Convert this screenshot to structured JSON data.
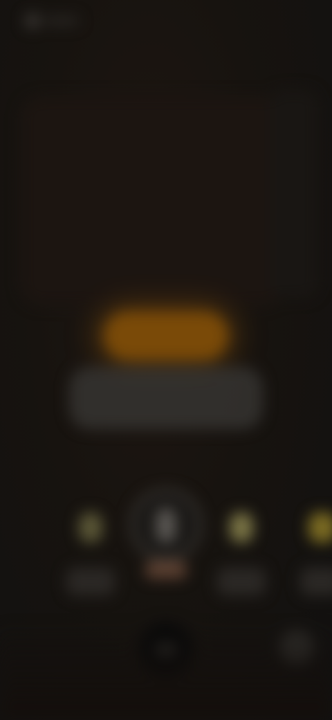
{
  "status_bar": {
    "icon": "clock-icon",
    "time_text": ""
  },
  "viewfinder": {
    "blurred": true
  },
  "countdown": {
    "indicator_text": "",
    "value_text": ""
  },
  "modes": [
    {
      "icon": "timer-icon",
      "label": ""
    },
    {
      "icon": "microphone-icon",
      "label": ""
    },
    {
      "icon": "lightbulb-icon",
      "label": ""
    },
    {
      "icon": "flash-icon",
      "label": ""
    }
  ],
  "controls": {
    "main_button_icon": "stop-icon",
    "secondary_button_icon": "switch-icon"
  },
  "colors": {
    "accent_amber": "#7a4a08",
    "active_label": "#5a3f30",
    "background": "#141210"
  }
}
